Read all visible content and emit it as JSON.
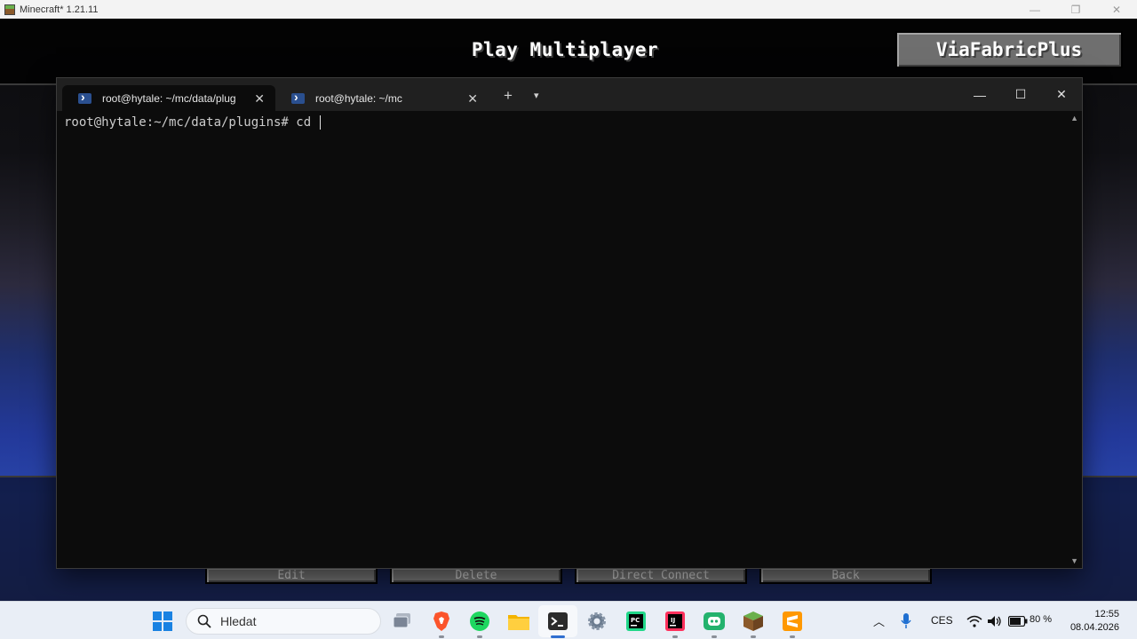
{
  "minecraft": {
    "window_title": "Minecraft* 1.21.11",
    "heading": "Play Multiplayer",
    "viafabricplus_button": "ViaFabricPlus",
    "bottom_buttons": [
      "Edit",
      "Delete",
      "Direct Connect",
      "Back"
    ]
  },
  "terminal": {
    "tabs": [
      {
        "label": "root@hytale: ~/mc/data/plug",
        "active": true
      },
      {
        "label": "root@hytale: ~/mc",
        "active": false
      }
    ],
    "new_tab_symbol": "+",
    "dropdown_symbol": "⌄",
    "prompt": "root@hytale:~/mc/data/plugins# ",
    "command": "cd "
  },
  "taskbar": {
    "search_placeholder": "Hledat",
    "apps": [
      "start-icon",
      "task-view-icon",
      "brave-icon",
      "spotify-icon",
      "file-explorer-icon",
      "terminal-icon",
      "settings-icon",
      "pycharm-icon",
      "intellij-icon",
      "discord-icon",
      "minecraft-icon",
      "sublime-text-icon"
    ],
    "language": "CES",
    "battery": "80 %",
    "time": "12:55",
    "date": "08.04.2026",
    "accent": "#2f6fd0"
  }
}
